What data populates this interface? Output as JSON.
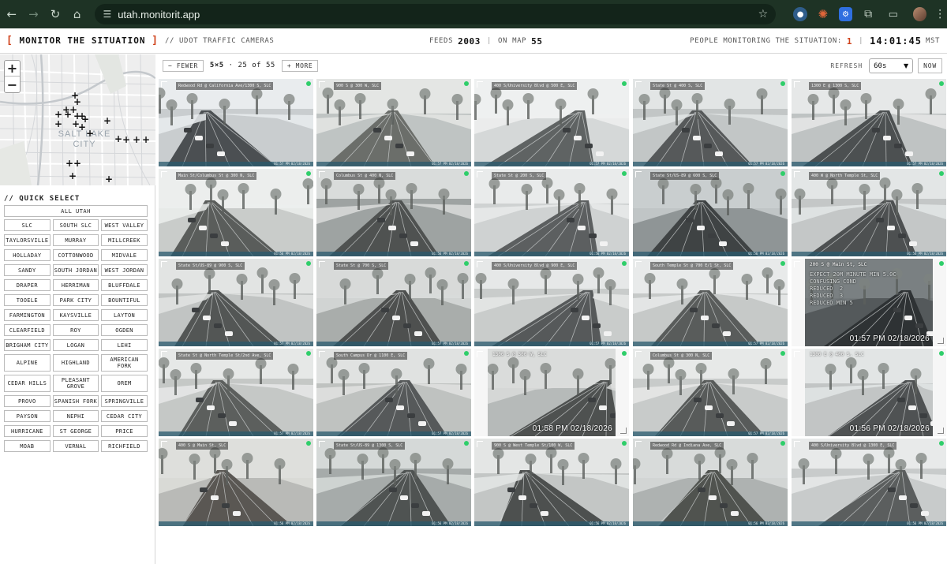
{
  "browser": {
    "url": "utah.monitorit.app",
    "back_icon": "arrow-left-icon",
    "forward_icon": "arrow-right-icon",
    "reload_icon": "reload-icon",
    "home_icon": "home-icon",
    "site_settings_icon": "tune-icon",
    "bookmark_icon": "star-icon"
  },
  "header": {
    "brand_open": "[",
    "brand_text": "MONITOR THE SITUATION",
    "brand_close": "]",
    "subtitle": "// UDOT TRAFFIC CAMERAS",
    "feeds_label": "FEEDS",
    "feeds_value": "2003",
    "separator": "|",
    "on_map_label": "ON MAP",
    "on_map_value": "55",
    "people_label": "PEOPLE MONITORING THE SITUATION:",
    "people_value": "1",
    "clock": "14:01:45",
    "timezone": "MST"
  },
  "map": {
    "zoom_in": "+",
    "zoom_out": "−",
    "city_label_line1": "SALT LAKE",
    "city_label_line2": "CITY",
    "marker_glyph": "+"
  },
  "quick_select": {
    "title": "// QUICK SELECT",
    "all": "ALL UTAH",
    "regions": [
      [
        "SLC",
        "SOUTH SLC",
        "WEST VALLEY"
      ],
      [
        "TAYLORSVILLE",
        "MURRAY",
        "MILLCREEK"
      ],
      [
        "HOLLADAY",
        "COTTONWOOD",
        "MIDVALE"
      ],
      [
        "SANDY",
        "SOUTH JORDAN",
        "WEST JORDAN"
      ],
      [
        "DRAPER",
        "HERRIMAN",
        "BLUFFDALE"
      ],
      [
        "TOOELE",
        "PARK CITY",
        "BOUNTIFUL"
      ],
      [
        "FARMINGTON",
        "KAYSVILLE",
        "LAYTON"
      ],
      [
        "CLEARFIELD",
        "ROY",
        "OGDEN"
      ],
      [
        "BRIGHAM CITY",
        "LOGAN",
        "LEHI"
      ],
      [
        "ALPINE",
        "HIGHLAND",
        "AMERICAN FORK"
      ],
      [
        "CEDAR HILLS",
        "PLEASANT GROVE",
        "OREM"
      ],
      [
        "PROVO",
        "SPANISH FORK",
        "SPRINGVILLE"
      ],
      [
        "PAYSON",
        "NEPHI",
        "CEDAR CITY"
      ],
      [
        "HURRICANE",
        "ST GEORGE",
        "PRICE"
      ],
      [
        "MOAB",
        "VERNAL",
        "RICHFIELD"
      ]
    ]
  },
  "toolbar": {
    "fewer_label": "− FEWER",
    "grid_size": "5×5",
    "dot": "·",
    "shown": "25",
    "of_word": "of",
    "total": "55",
    "more_label": "+ MORE",
    "refresh_label": "REFRESH",
    "refresh_value": "60s",
    "now_label": "NOW"
  },
  "cameras": [
    {
      "label": "Redwood Rd @ California Ave/1300 S, SLC",
      "stamp": "01:57 PM 02/18/2026",
      "style": "std",
      "palette": [
        "#c9cdcf",
        "#4b4f52",
        "#e9ecee"
      ]
    },
    {
      "label": "900 S @ 300 W, SLC",
      "stamp": "01:57 PM 02/18/2026",
      "style": "std",
      "palette": [
        "#bfc4c3",
        "#6b6e6a",
        "#e4e6e4"
      ]
    },
    {
      "label": "400 S/University Blvd @ 500 E, SLC",
      "stamp": "01:57 PM 02/18/2026",
      "style": "std",
      "palette": [
        "#d5d8d8",
        "#5f6363",
        "#eef0f0"
      ]
    },
    {
      "label": "State St @ 400 S, SLC",
      "stamp": "01:57 PM 02/18/2026",
      "style": "std",
      "palette": [
        "#c2c6c6",
        "#56595a",
        "#e2e5e5"
      ]
    },
    {
      "label": "1300 E @ 1300 S, SLC",
      "stamp": "01:57 PM 02/18/2026",
      "style": "std",
      "palette": [
        "#bfc3c3",
        "#4c5051",
        "#e6e8e8"
      ]
    },
    {
      "label": "Main St/Columbus St @ 300 N, SLC",
      "stamp": "01:56 PM 02/18/2026",
      "style": "std",
      "palette": [
        "#c9ccca",
        "#5a5d5b",
        "#eceeed"
      ]
    },
    {
      "label": "Columbus St @ 400 N, SLC",
      "stamp": "01:56 PM 02/18/2026",
      "style": "std",
      "palette": [
        "#9ea3a2",
        "#4f5251",
        "#d9dcdb"
      ]
    },
    {
      "label": "State St @ 200 S, SLC",
      "stamp": "01:56 PM 02/18/2026",
      "style": "std",
      "palette": [
        "#cfd2d2",
        "#5c5f60",
        "#e9ebeb"
      ]
    },
    {
      "label": "State St/US-89 @ 600 S, SLC",
      "stamp": "01:56 PM 02/18/2026",
      "style": "std",
      "palette": [
        "#8f9596",
        "#3f4344",
        "#c9cecf"
      ]
    },
    {
      "label": "400 W @ North Temple St, SLC",
      "stamp": "01:56 PM 02/18/2026",
      "style": "std",
      "palette": [
        "#c4c7c7",
        "#4d5051",
        "#e3e6e6"
      ]
    },
    {
      "label": "State St/US-89 @ 900 S, SLC",
      "stamp": "01:57 PM 02/18/2026",
      "style": "std",
      "palette": [
        "#c1c4c3",
        "#535655",
        "#e2e4e3"
      ]
    },
    {
      "label": "State St @ 700 S, SLC",
      "stamp": "01:57 PM 02/18/2026",
      "style": "std",
      "palette": [
        "#a9adab",
        "#4e504f",
        "#d8dad9"
      ]
    },
    {
      "label": "400 S/University Blvd @ 900 E, SLC",
      "stamp": "01:57 PM 02/18/2026",
      "style": "std",
      "palette": [
        "#c9cccb",
        "#56595a",
        "#e6e8e8"
      ]
    },
    {
      "label": "South Temple St @ 700 E/1 St, SLC",
      "stamp": "01:57 PM 02/18/2026",
      "style": "std",
      "palette": [
        "#c6c9c8",
        "#595c5b",
        "#e8eaea"
      ]
    },
    {
      "label": "200 S @ Main St, SLC",
      "stamp": "01:57 PM 02/18/2026",
      "style": "dark",
      "text": "EXPECT 20M MINUTE MIN 5.0C\nCONFUSING COND\nREDUCED  2\nREDUCED  3\nREDUCED MIN 5",
      "palette": [
        "#54595b",
        "#2e3234",
        "#7a8082"
      ]
    },
    {
      "label": "State St @ North Temple St/2nd Ave, SLC",
      "stamp": "01:57 PM 02/18/2026",
      "style": "std",
      "palette": [
        "#c5c8c6",
        "#5c5f5d",
        "#e6e8e7"
      ]
    },
    {
      "label": "South Campus Dr @ 1100 E, SLC",
      "stamp": "01:57 PM 02/18/2026",
      "style": "std",
      "palette": [
        "#bfc2c0",
        "#56595a",
        "#e0e2e1"
      ]
    },
    {
      "label": "1300 S @ 300 W, SLC",
      "stamp": "01:58 PM 02/18/2026",
      "style": "framed",
      "palette": [
        "#b6bab9",
        "#4e5150",
        "#dadcdb"
      ]
    },
    {
      "label": "Columbus St @ 300 N, SLC",
      "stamp": "01:57 PM 02/18/2026",
      "style": "std",
      "palette": [
        "#c8cbca",
        "#585b5a",
        "#e7e9e8"
      ]
    },
    {
      "label": "1300 E @ 400 S, SLC",
      "stamp": "01:56 PM 02/18/2026",
      "style": "framed",
      "palette": [
        "#c2c5c5",
        "#4f5253",
        "#e2e5e5"
      ]
    },
    {
      "label": "400 S @ Main St, SLC",
      "stamp": "01:56 PM 02/18/2026",
      "style": "std",
      "palette": [
        "#b9bab7",
        "#5a5753",
        "#dedfdc"
      ]
    },
    {
      "label": "State St/US-89 @ 1300 S, SLC",
      "stamp": "01:56 PM 02/18/2026",
      "style": "std",
      "palette": [
        "#a6abaa",
        "#4f5352",
        "#d5d9d8"
      ]
    },
    {
      "label": "900 S @ West Temple St/100 W, SLC",
      "stamp": "01:56 PM 02/18/2026",
      "style": "std",
      "palette": [
        "#c3c6c5",
        "#4d504f",
        "#e4e6e5"
      ]
    },
    {
      "label": "Redwood Rd @ Indiana Ave, SLC",
      "stamp": "01:56 PM 02/18/2026",
      "style": "std",
      "palette": [
        "#aeb2b1",
        "#50534f",
        "#d8dbda"
      ]
    },
    {
      "label": "400 S/University Blvd @ 1300 E, SLC",
      "stamp": "01:56 PM 02/18/2026",
      "style": "std",
      "palette": [
        "#c8cbcb",
        "#5b5e5e",
        "#e8eaea"
      ]
    }
  ],
  "colors": {
    "accent": "#d0421b",
    "live": "#2fce6a",
    "chrome": "#1e3325"
  }
}
